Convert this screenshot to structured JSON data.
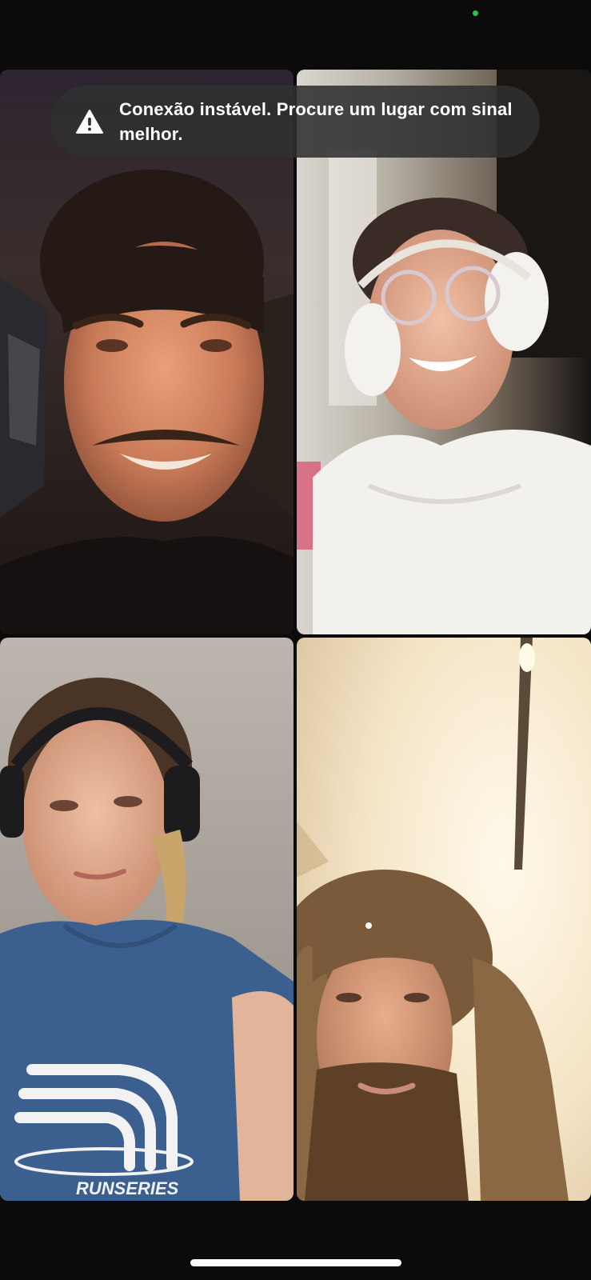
{
  "status_bar": {
    "camera_indicator_color": "#2bc24a"
  },
  "toast": {
    "icon": "warning-triangle-icon",
    "message": "Conexão instável. Procure um lugar com sinal melhor."
  },
  "participants": [
    {
      "position": "top-left",
      "icon": "video-feed"
    },
    {
      "position": "top-right",
      "icon": "video-feed"
    },
    {
      "position": "bottom-left",
      "icon": "video-feed",
      "shirt_text": "RUNSERIES"
    },
    {
      "position": "bottom-right",
      "icon": "video-feed"
    }
  ],
  "home_indicator": {
    "color": "#ffffff"
  }
}
